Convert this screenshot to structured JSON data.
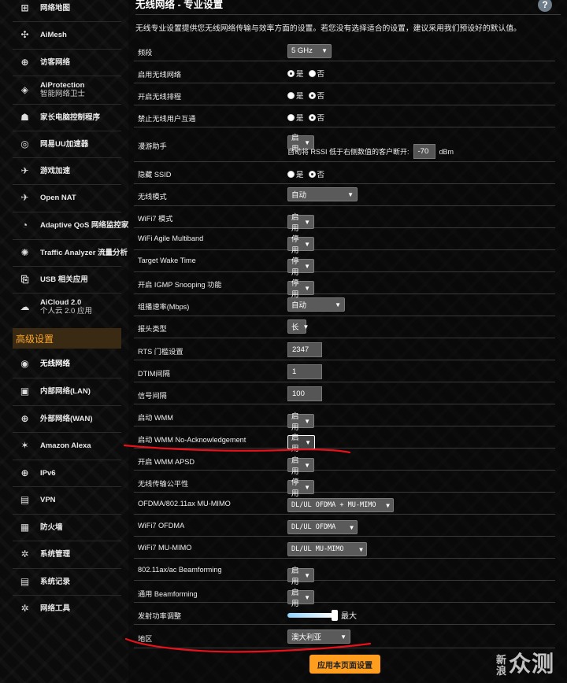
{
  "sidebar": {
    "items": [
      {
        "label": "网络地图",
        "icon": "network-map-icon",
        "glyph": "⊞"
      },
      {
        "label": "AiMesh",
        "icon": "mesh-icon",
        "glyph": "✣"
      },
      {
        "label": "访客网络",
        "icon": "guest-network-icon",
        "glyph": "⊕"
      },
      {
        "label": "AiProtection",
        "sub": "智能网络卫士",
        "icon": "shield-icon",
        "glyph": "◈"
      },
      {
        "label": "家长电脑控制程序",
        "icon": "parental-control-icon",
        "glyph": "☗"
      },
      {
        "label": "网易UU加速器",
        "icon": "accelerator-icon",
        "glyph": "◎"
      },
      {
        "label": "游戏加速",
        "icon": "game-boost-icon",
        "glyph": "✈"
      },
      {
        "label": "Open NAT",
        "icon": "open-nat-icon",
        "glyph": "✈"
      },
      {
        "label": "Adaptive QoS 网络监控家",
        "icon": "qos-gauge-icon",
        "glyph": "◔"
      },
      {
        "label": "Traffic Analyzer 流量分析",
        "icon": "traffic-analyzer-icon",
        "glyph": "✺"
      },
      {
        "label": "USB 相关应用",
        "icon": "usb-icon",
        "glyph": "⎘"
      },
      {
        "label": "AiCloud 2.0",
        "sub": "个人云 2.0 应用",
        "icon": "cloud-icon",
        "glyph": "☁"
      }
    ],
    "section_header": "高级设置",
    "advanced_items": [
      {
        "label": "无线网络",
        "icon": "wireless-icon",
        "glyph": "◉",
        "active": true
      },
      {
        "label": "内部网络(LAN)",
        "icon": "lan-icon",
        "glyph": "▣"
      },
      {
        "label": "外部网络(WAN)",
        "icon": "wan-globe-icon",
        "glyph": "⊕"
      },
      {
        "label": "Amazon Alexa",
        "icon": "alexa-icon",
        "glyph": "✶"
      },
      {
        "label": "IPv6",
        "icon": "ipv6-icon",
        "glyph": "⊕"
      },
      {
        "label": "VPN",
        "icon": "vpn-icon",
        "glyph": "▤"
      },
      {
        "label": "防火墙",
        "icon": "firewall-icon",
        "glyph": "▦"
      },
      {
        "label": "系统管理",
        "icon": "admin-gear-icon",
        "glyph": "✲"
      },
      {
        "label": "系统记录",
        "icon": "system-log-icon",
        "glyph": "▤"
      },
      {
        "label": "网络工具",
        "icon": "network-tools-icon",
        "glyph": "✲"
      }
    ]
  },
  "main": {
    "title": "无线网络 - 专业设置",
    "help": "?",
    "description": "无线专业设置提供您无线网络传输与效率方面的设置。若您没有选择适合的设置，建议采用我们预设好的默认值。",
    "yes": "是",
    "no": "否",
    "rows": {
      "band": {
        "label": "频段",
        "value": "5 GHz"
      },
      "enable_radio": {
        "label": "启用无线网络"
      },
      "schedule": {
        "label": "开启无线排程"
      },
      "isolation": {
        "label": "禁止无线用户互通"
      },
      "roaming": {
        "label": "漫游助手",
        "value": "启用",
        "rssi_text": "自动将 RSSI 低于右侧数值的客户断开:",
        "rssi_value": "-70",
        "rssi_unit": "dBm"
      },
      "hide_ssid": {
        "label": "隐藏 SSID"
      },
      "wireless_mode": {
        "label": "无线模式",
        "value": "自动"
      },
      "wifi7_mode": {
        "label": "WiFi7 模式",
        "value": "启用"
      },
      "agile_multiband": {
        "label": "WiFi Agile Multiband",
        "value": "停用"
      },
      "twt": {
        "label": "Target Wake Time",
        "value": "停用"
      },
      "igmp": {
        "label": "开启 IGMP Snooping 功能",
        "value": "停用"
      },
      "multicast_rate": {
        "label": "组播速率(Mbps)",
        "value": "自动"
      },
      "preamble": {
        "label": "报头类型",
        "value": "长"
      },
      "rts": {
        "label": "RTS 门槛设置",
        "value": "2347"
      },
      "dtim": {
        "label": "DTIM间隔",
        "value": "1"
      },
      "beacon": {
        "label": "信号间隔",
        "value": "100"
      },
      "wmm": {
        "label": "启动 WMM",
        "value": "启用"
      },
      "wmm_noack": {
        "label": "启动 WMM No-Acknowledgement",
        "value": "启用"
      },
      "wmm_apsd": {
        "label": "开启 WMM APSD",
        "value": "启用"
      },
      "airtime": {
        "label": "无线传输公平性",
        "value": "停用"
      },
      "mu_mimo": {
        "label": "OFDMA/802.11ax MU-MIMO",
        "value": "DL/UL OFDMA + MU-MIMO"
      },
      "wifi7_ofdma": {
        "label": "WiFi7 OFDMA",
        "value": "DL/UL OFDMA"
      },
      "wifi7_mumimo": {
        "label": "WiFi7 MU-MIMO",
        "value": "DL/UL MU-MIMO"
      },
      "beamforming_ax": {
        "label": "802.11ax/ac Beamforming",
        "value": "启用"
      },
      "beamforming": {
        "label": "通用 Beamforming",
        "value": "启用"
      },
      "tx_power": {
        "label": "发射功率调整",
        "value_text": "最大",
        "level": 1.0
      },
      "region": {
        "label": "地区",
        "value": "澳大利亚"
      }
    },
    "apply_label": "应用本页面设置"
  },
  "watermark": {
    "small": "新浪",
    "big": "众测"
  },
  "colors": {
    "accent": "#ff9d1f",
    "annotation": "#e8101a",
    "section_text": "#ffa826"
  }
}
